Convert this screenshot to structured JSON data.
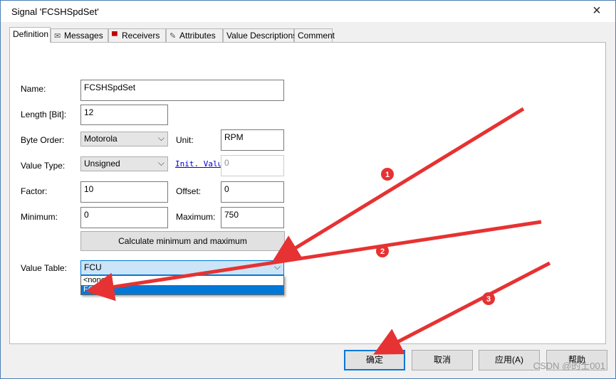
{
  "window": {
    "title": "Signal 'FCSHSpdSet'",
    "close_glyph": "×"
  },
  "tabs": [
    {
      "label": "Definition",
      "icon": ""
    },
    {
      "label": "Messages",
      "icon": "envelope-icon"
    },
    {
      "label": "Receivers",
      "icon": "receiver-icon"
    },
    {
      "label": "Attributes",
      "icon": "attributes-icon"
    },
    {
      "label": "Value Descriptions",
      "icon": ""
    },
    {
      "label": "Comment",
      "icon": ""
    }
  ],
  "form": {
    "name_label": "Name:",
    "name_value": "FCSHSpdSet",
    "length_label": "Length [Bit]:",
    "length_value": "12",
    "byte_order_label": "Byte Order:",
    "byte_order_value": "Motorola",
    "unit_label": "Unit:",
    "unit_value": "RPM",
    "value_type_label": "Value Type:",
    "value_type_value": "Unsigned",
    "init_value_link": "Init. Value:",
    "init_value": "0",
    "factor_label": "Factor:",
    "factor_value": "10",
    "offset_label": "Offset:",
    "offset_value": "0",
    "minimum_label": "Minimum:",
    "minimum_value": "0",
    "maximum_label": "Maximum:",
    "maximum_value": "750",
    "calc_button": "Calculate minimum and maximum",
    "value_table_label": "Value Table:",
    "value_table_value": "FCU",
    "value_table_options": [
      "<none>",
      "FCU"
    ],
    "value_table_selected_index": 1
  },
  "buttons": {
    "ok": "确定",
    "cancel": "取消",
    "apply": "应用(A)",
    "help": "帮助"
  },
  "annotations": {
    "step1": "1",
    "step2": "2",
    "step3": "3",
    "color": "#e63232"
  },
  "watermark": "CSDN @的士001",
  "colors": {
    "accent": "#0078d7",
    "titlebar_border": "#4a7fb8"
  }
}
